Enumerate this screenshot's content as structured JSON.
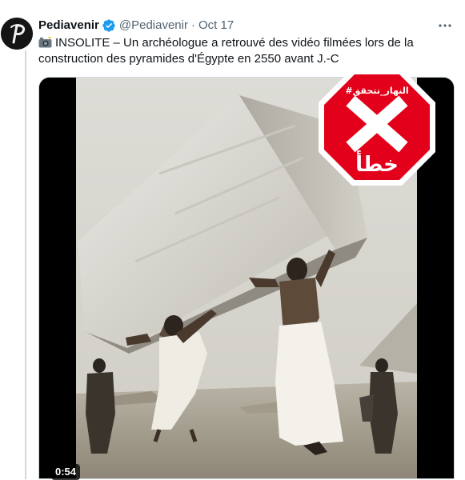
{
  "author": {
    "display_name": "Pediavenir",
    "handle": "@Pediavenir",
    "separator": "·",
    "date": "Oct 17",
    "verified": true,
    "avatar_icon": "pediavenir-logo-icon"
  },
  "more_icon": "more-horizontal-icon",
  "tweet": {
    "emoji_icon": "camera-flash-icon",
    "text": "INSOLITE – Un archéologue a retrouvé des vidéo filmées lors de la construction des pyramides d'Égypte en 2550 avant J.-C"
  },
  "media": {
    "type": "video",
    "duration": "0:54",
    "description_icon": "sepia-video-thumbnail"
  },
  "fact_check_stamp": {
    "tag": "#النهار_تتحقق",
    "verdict": "خطأ",
    "color": "#e2001a"
  },
  "colors": {
    "text": "#0f1419",
    "muted": "#536471",
    "verified": "#1d9bf0",
    "border": "#cfd9de"
  }
}
